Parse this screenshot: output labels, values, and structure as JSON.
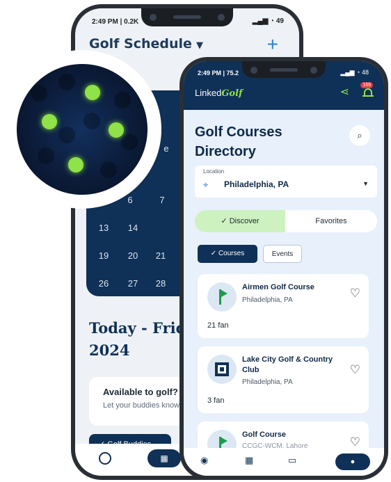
{
  "back_phone": {
    "status_time": "2:49 PM | 0.2K",
    "battery": "49",
    "header_title": "Golf Schedule",
    "calendar_days": [
      "e",
      "6",
      "7",
      "13",
      "14",
      "19",
      "20",
      "21",
      "26",
      "27",
      "28"
    ],
    "today_title": "Today - Frida",
    "today_year": "2024",
    "available_title": "Available to golf?",
    "available_sub": "Let your buddies know",
    "buddies_button": "Golf Buddies"
  },
  "magnifier": {
    "dot_color": "#8fe247",
    "bg_color": "#0b1a36"
  },
  "front_phone": {
    "status_time": "2:49 PM | 75.2",
    "battery": "48",
    "logo_prefix": "Linked",
    "logo_suffix": "Golf",
    "notification_count": "169",
    "directory_title_line1": "Golf Courses",
    "directory_title_line2": "Directory",
    "location_label": "Location",
    "location_value": "Philadelphia,  PA",
    "segment_discover": "Discover",
    "segment_favorites": "Favorites",
    "chip_courses": "Courses",
    "chip_events": "Events",
    "courses": [
      {
        "name": "Airmen Golf Course",
        "city": "Philadelphia,  PA",
        "fans": "21 fan"
      },
      {
        "name": "Lake City Golf & Country Club",
        "city": "Philadelphia,  PA",
        "fans": "3 fan"
      },
      {
        "name": "Golf Course",
        "city": "CCGC-WCM, Lahore"
      }
    ],
    "accent_color": "#8fe247",
    "navy_color": "#0f3057"
  }
}
